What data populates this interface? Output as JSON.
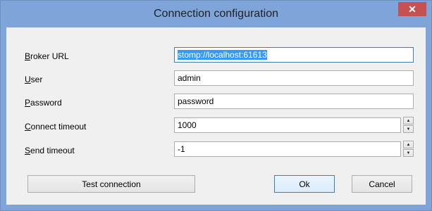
{
  "window": {
    "title": "Connection configuration",
    "close_glyph": "✕"
  },
  "form": {
    "broker_url": {
      "label_mnemonic": "B",
      "label_rest": "roker URL",
      "value": "stomp://localhost:61613"
    },
    "user": {
      "label_mnemonic": "U",
      "label_rest": "ser",
      "value": "admin"
    },
    "password": {
      "label_mnemonic": "P",
      "label_rest": "assword",
      "value": "password"
    },
    "connect_timeout": {
      "label_mnemonic": "C",
      "label_rest": "onnect timeout",
      "value": "1000"
    },
    "send_timeout": {
      "label_mnemonic": "S",
      "label_rest": "end timeout",
      "value": "-1"
    }
  },
  "buttons": {
    "test_connection": "Test connection",
    "ok": "Ok",
    "cancel": "Cancel"
  },
  "icons": {
    "close": "close-icon",
    "spin_up": "arrow-up-icon",
    "spin_down": "arrow-down-icon"
  },
  "colors": {
    "titlebar": "#7ea4d9",
    "close_button": "#c75050",
    "selection": "#3399ff",
    "client_background": "#f0f0f0"
  }
}
